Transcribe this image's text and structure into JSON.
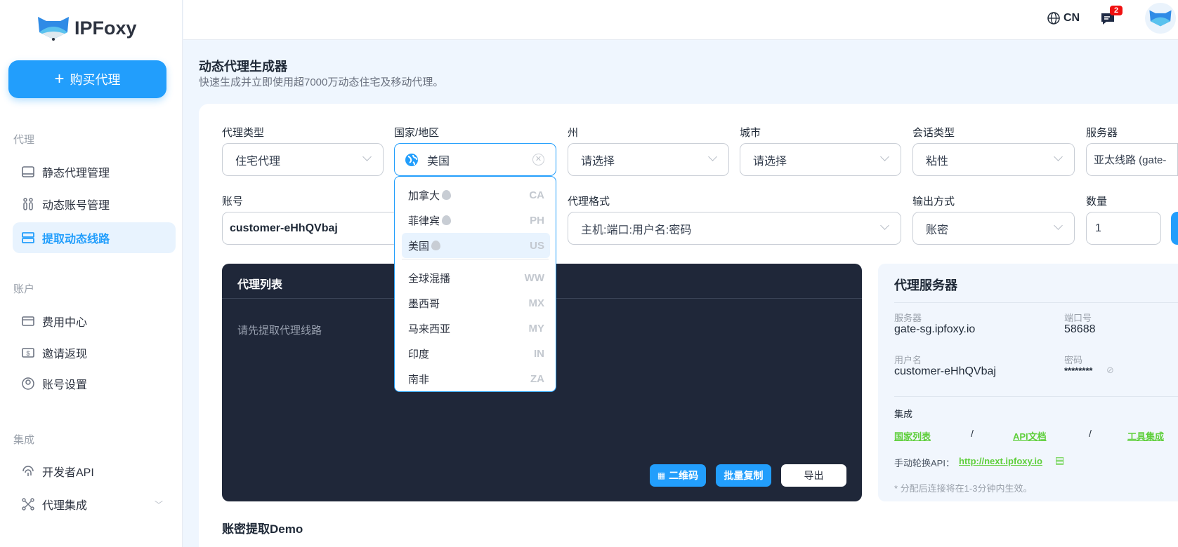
{
  "brand": "IPFoxy",
  "buy_label": "购买代理",
  "sidebar": {
    "sections": [
      {
        "title": "代理",
        "items": [
          {
            "label": "静态代理管理"
          },
          {
            "label": "动态账号管理"
          },
          {
            "label": "提取动态线路",
            "active": true
          }
        ]
      },
      {
        "title": "账户",
        "items": [
          {
            "label": "费用中心"
          },
          {
            "label": "邀请返现"
          },
          {
            "label": "账号设置"
          }
        ]
      },
      {
        "title": "集成",
        "items": [
          {
            "label": "开发者API"
          },
          {
            "label": "代理集成"
          }
        ]
      }
    ]
  },
  "topbar": {
    "language": "CN",
    "messages_count": "2"
  },
  "page": {
    "title": "动态代理生成器",
    "subtitle": "快速生成并立即使用超7000万动态住宅及移动代理。"
  },
  "form": {
    "proxy_type": {
      "label": "代理类型",
      "value": "住宅代理"
    },
    "country": {
      "label": "国家/地区",
      "value": "美国"
    },
    "state": {
      "label": "州",
      "value": "请选择"
    },
    "city": {
      "label": "城市",
      "value": "请选择"
    },
    "session": {
      "label": "会话类型",
      "value": "粘性"
    },
    "server": {
      "label": "服务器",
      "value": "亚太线路 (gate-"
    },
    "account": {
      "label": "账号",
      "value": "customer-eHhQVbaj"
    },
    "format": {
      "label": "代理格式",
      "value": "主机:端口:用户名:密码"
    },
    "output": {
      "label": "输出方式",
      "value": "账密"
    },
    "quantity": {
      "label": "数量",
      "value": "1"
    }
  },
  "country_dropdown": [
    {
      "name": "加拿大",
      "code": "CA",
      "hot": true
    },
    {
      "name": "菲律宾",
      "code": "PH",
      "hot": true
    },
    {
      "name": "美国",
      "code": "US",
      "hot": true,
      "selected": true
    },
    {
      "name": "全球混播",
      "code": "WW"
    },
    {
      "name": "墨西哥",
      "code": "MX"
    },
    {
      "name": "马来西亚",
      "code": "MY"
    },
    {
      "name": "印度",
      "code": "IN"
    },
    {
      "name": "南非",
      "code": "ZA"
    }
  ],
  "proxy_list": {
    "title": "代理列表",
    "empty": "请先提取代理线路",
    "qr_label": "二维码",
    "copy_label": "批量复制",
    "export_label": "导出"
  },
  "server_panel": {
    "title": "代理服务器",
    "server_label": "服务器",
    "server": "gate-sg.ipfoxy.io",
    "port_label": "端口号",
    "port": "58688",
    "user_label": "用户名",
    "user": "customer-eHhQVbaj",
    "pass_label": "密码",
    "pass": "********",
    "integration_label": "集成",
    "links": [
      "国家列表",
      "API文档",
      "工具集成"
    ],
    "sep": "/",
    "rotate_label": "手动轮换API：",
    "rotate_url": "http://next.ipfoxy.io",
    "note": "* 分配后连接将在1-3分钟内生效。"
  },
  "demo_title": "账密提取Demo",
  "colors": {
    "accent": "#229efc",
    "dark": "#1f2739",
    "link": "#5fcf3c"
  }
}
